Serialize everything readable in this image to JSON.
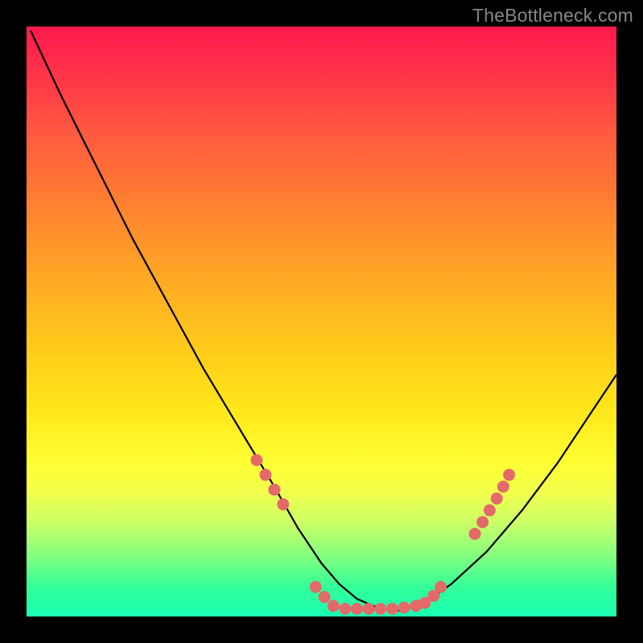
{
  "watermark": "TheBottleneck.com",
  "colors": {
    "frame": "#000000",
    "curve_stroke": "#000000",
    "marker_fill": "#e46a6a",
    "gradient_top": "#ff1a4d",
    "gradient_bottom": "#1affb3"
  },
  "chart_data": {
    "type": "line",
    "title": "",
    "xlabel": "",
    "ylabel": "",
    "xlim": [
      0,
      100
    ],
    "ylim": [
      0,
      100
    ],
    "series": [
      {
        "name": "curve",
        "x": [
          0.7,
          6,
          12,
          18,
          24,
          30,
          36,
          42,
          46,
          50,
          53,
          56,
          59.5,
          63,
          67,
          72,
          78,
          84,
          90,
          96,
          100
        ],
        "y": [
          99.3,
          88,
          76,
          64,
          53,
          42,
          32,
          22,
          15,
          9,
          5.5,
          3,
          1.5,
          1,
          2,
          5.5,
          11,
          18,
          26,
          35,
          41
        ]
      }
    ],
    "markers": [
      {
        "x": 39,
        "y": 26.5
      },
      {
        "x": 40.5,
        "y": 24
      },
      {
        "x": 42,
        "y": 21.5
      },
      {
        "x": 43.5,
        "y": 19
      },
      {
        "x": 49,
        "y": 5
      },
      {
        "x": 50.5,
        "y": 3.3
      },
      {
        "x": 52,
        "y": 1.8
      },
      {
        "x": 54,
        "y": 1.3
      },
      {
        "x": 56,
        "y": 1.3
      },
      {
        "x": 58,
        "y": 1.3
      },
      {
        "x": 60,
        "y": 1.3
      },
      {
        "x": 62,
        "y": 1.3
      },
      {
        "x": 64,
        "y": 1.5
      },
      {
        "x": 66,
        "y": 1.8
      },
      {
        "x": 67.5,
        "y": 2.3
      },
      {
        "x": 69,
        "y": 3.5
      },
      {
        "x": 70.2,
        "y": 5
      },
      {
        "x": 76,
        "y": 14
      },
      {
        "x": 77.3,
        "y": 16
      },
      {
        "x": 78.5,
        "y": 18
      },
      {
        "x": 79.7,
        "y": 20
      },
      {
        "x": 80.8,
        "y": 22
      },
      {
        "x": 81.8,
        "y": 24
      }
    ]
  }
}
